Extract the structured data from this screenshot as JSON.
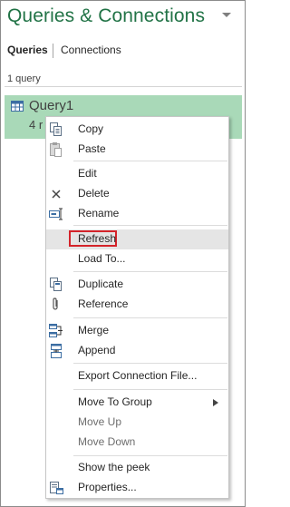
{
  "pane": {
    "title": "Queries & Connections"
  },
  "tabs": {
    "queries": "Queries",
    "connections": "Connections"
  },
  "query_count": "1 query",
  "query": {
    "name": "Query1",
    "rows_partial": "4 r"
  },
  "colors": {
    "accent": "#217346",
    "selected_card": "#a9d9b8",
    "highlight_box": "#d4232a",
    "menu_hover": "#e5e5e5"
  },
  "context_menu": {
    "items": [
      {
        "label": "Copy",
        "icon": "copy-icon",
        "enabled": true
      },
      {
        "label": "Paste",
        "icon": "paste-icon",
        "enabled": true
      },
      {
        "label": "Edit",
        "icon": "",
        "enabled": true
      },
      {
        "label": "Delete",
        "icon": "delete-x-icon",
        "enabled": true
      },
      {
        "label": "Rename",
        "icon": "rename-icon",
        "enabled": true
      },
      {
        "label": "Refresh",
        "icon": "",
        "enabled": true,
        "highlighted": true
      },
      {
        "label": "Load To...",
        "icon": "",
        "enabled": true
      },
      {
        "label": "Duplicate",
        "icon": "duplicate-icon",
        "enabled": true
      },
      {
        "label": "Reference",
        "icon": "reference-paperclip-icon",
        "enabled": true
      },
      {
        "label": "Merge",
        "icon": "merge-icon",
        "enabled": true
      },
      {
        "label": "Append",
        "icon": "append-icon",
        "enabled": true
      },
      {
        "label": "Export Connection File...",
        "icon": "",
        "enabled": true
      },
      {
        "label": "Move To Group",
        "icon": "",
        "enabled": true,
        "submenu": true
      },
      {
        "label": "Move Up",
        "icon": "",
        "enabled": false
      },
      {
        "label": "Move Down",
        "icon": "",
        "enabled": false
      },
      {
        "label": "Show the peek",
        "icon": "",
        "enabled": true
      },
      {
        "label": "Properties...",
        "icon": "properties-icon",
        "enabled": true
      }
    ]
  }
}
